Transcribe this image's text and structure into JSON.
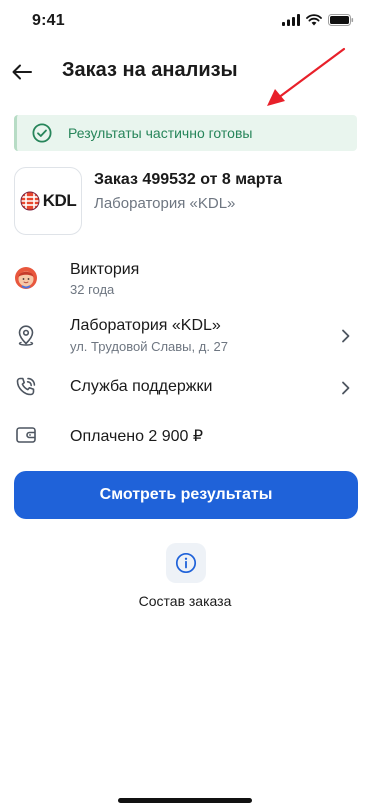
{
  "status_bar": {
    "time": "9:41"
  },
  "header": {
    "title": "Заказ на анализы"
  },
  "banner": {
    "text": "Результаты частично готовы",
    "color": "#27855a",
    "background": "#e9f5ee"
  },
  "order": {
    "logo_text": "KDL",
    "title": "Заказ 499532 от 8 марта",
    "lab": "Лаборатория «KDL»"
  },
  "patient": {
    "name": "Виктория",
    "age": "32 года"
  },
  "laboratory": {
    "name": "Лаборатория «KDL»",
    "address": "ул. Трудовой Славы, д. 27"
  },
  "support": {
    "label": "Служба поддержки"
  },
  "payment": {
    "label": "Оплачено 2 900 ₽"
  },
  "actions": {
    "view_results": "Смотреть результаты",
    "order_contents": "Состав заказа"
  },
  "colors": {
    "accent": "#1f62d9",
    "annotation_arrow": "#e8202a"
  }
}
